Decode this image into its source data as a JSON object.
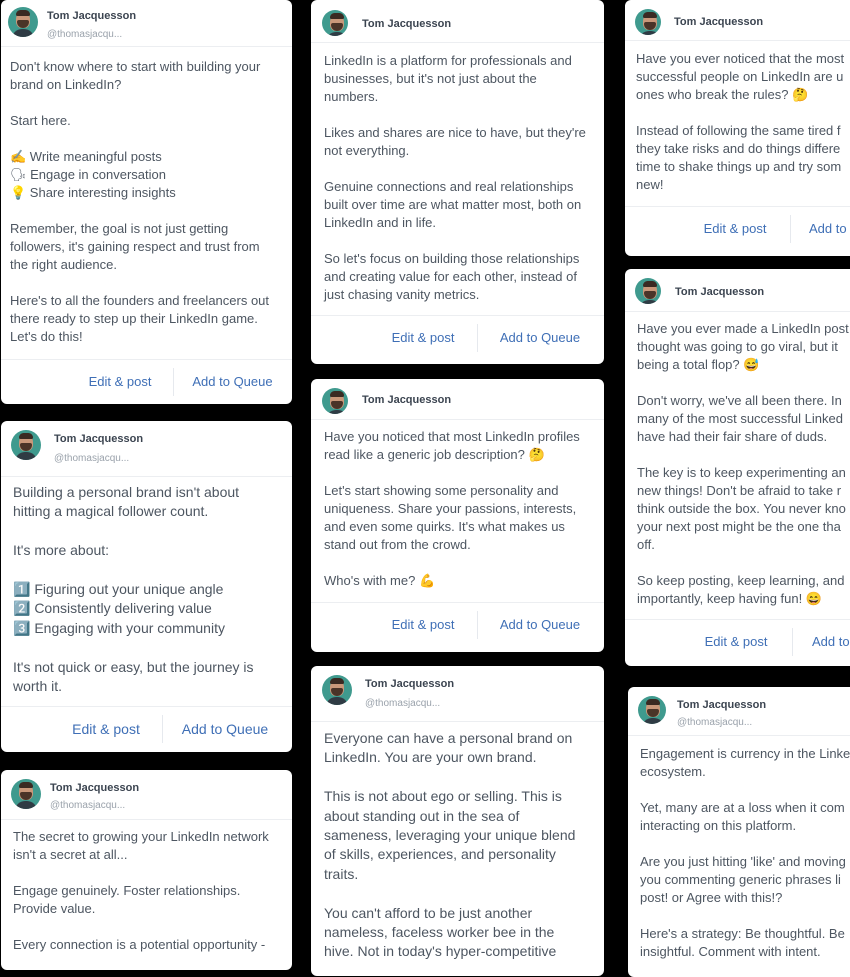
{
  "author": {
    "name": "Tom Jacquesson",
    "handle": "@thomasjacqu..."
  },
  "actions": {
    "edit": "Edit & post",
    "queue": "Add to Queue",
    "queue_cut": "Add to",
    "queue_cut2": "Add to"
  },
  "posts": [
    {
      "text": "Don't know where to start with building your\nbrand on LinkedIn?\n\nStart here.\n\n✍ Write meaningful posts\n🗣 Engage in conversation\n💡 Share interesting insights\n\nRemember, the goal is not just getting\nfollowers, it's gaining respect and trust from\nthe right audience.\n\nHere's to all the founders and freelancers out\nthere ready to step up their LinkedIn game.\nLet's do this!"
    },
    {
      "text": "Building a personal brand isn't about\nhitting a magical follower count.\n\nIt's more about:\n\n1️⃣ Figuring out your unique angle\n2️⃣ Consistently delivering value\n3️⃣ Engaging with your community\n\nIt's not quick or easy, but the journey is\nworth it."
    },
    {
      "text": "The secret to growing your LinkedIn network\nisn't a secret at all...\n\nEngage genuinely. Foster relationships.\nProvide value.\n\nEvery connection is a potential opportunity -"
    },
    {
      "text": "LinkedIn is a platform for professionals and\nbusinesses, but it's not just about the\nnumbers.\n\nLikes and shares are nice to have, but they're\nnot everything.\n\nGenuine connections and real relationships\nbuilt over time are what matter most, both on\nLinkedIn and in life.\n\nSo let's focus on building those relationships\nand creating value for each other, instead of\njust chasing vanity metrics."
    },
    {
      "text": "Have you noticed that most LinkedIn profiles\nread like a generic job description? 🤔\n\nLet's start showing some personality and\nuniqueness. Share your passions, interests,\nand even some quirks. It's what makes us\nstand out from the crowd.\n\nWho's with me? 💪"
    },
    {
      "text": "Everyone can have a personal brand on\nLinkedIn. You are your own brand.\n\nThis is not about ego or selling. This is\nabout standing out in the sea of\nsameness, leveraging your unique blend\nof skills, experiences, and personality\ntraits.\n\nYou can't afford to be just another\nnameless, faceless worker bee in the\nhive. Not in today's hyper-competitive"
    },
    {
      "text": "Have you ever noticed that the most\nsuccessful people on LinkedIn are u\nones who break the rules? 🤔\n\nInstead of following the same tired f\nthey take risks and do things differe\ntime to shake things up and try som\nnew!"
    },
    {
      "text": "Have you ever made a LinkedIn post\nthought was going to go viral, but it\nbeing a total flop? 😅\n\nDon't worry, we've all been there. In\nmany of the most successful Linked\nhave had their fair share of duds.\n\nThe key is to keep experimenting an\nnew things! Don't be afraid to take r\nthink outside the box. You never kno\nyour next post might be the one tha\noff.\n\nSo keep posting, keep learning, and\nimportantly, keep having fun! 😄"
    },
    {
      "text": "Engagement is currency in the Linke\necosystem.\n\nYet, many are at a loss when it com\ninteracting on this platform.\n\nAre you just hitting 'like' and moving\nyou commenting generic phrases li\npost! or Agree with this!?\n\nHere's a strategy: Be thoughtful. Be\ninsightful. Comment with intent."
    }
  ]
}
